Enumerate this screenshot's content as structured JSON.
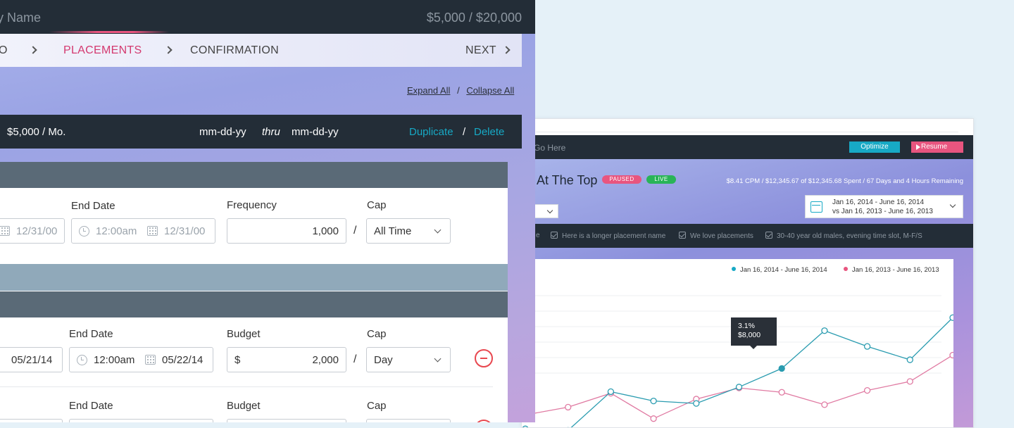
{
  "left": {
    "header": {
      "name": "y Name",
      "budget": "$5,000 / $20,000"
    },
    "steps": {
      "prev": "O",
      "current": "PLACEMENTS",
      "next_step": "CONFIRMATION",
      "next": "NEXT"
    },
    "expand_all": "Expand All",
    "collapse_all": "Collapse All",
    "expand_sep": "/",
    "row": {
      "budget": "$5,000 / Mo.",
      "start": "mm-dd-yy",
      "thru": "thru",
      "end": "mm-dd-yy",
      "duplicate": "Duplicate",
      "sep": "/",
      "delete": "Delete"
    },
    "section1": {
      "start_date": "12/31/00",
      "end_label": "End Date",
      "end_time": "12:00am",
      "end_date": "12/31/00",
      "freq_label": "Frequency",
      "freq_value": "1,000",
      "slash": "/",
      "cap_label": "Cap",
      "cap_value": "All Time"
    },
    "row2": {
      "start_date": "05/21/14",
      "end_label": "End Date",
      "end_time": "12:00am",
      "end_date": "05/22/14",
      "budget_label": "Budget",
      "currency": "$",
      "budget_value": "2,000",
      "slash": "/",
      "cap_label": "Cap",
      "cap_value": "Day"
    },
    "row3": {
      "end_label": "End Date",
      "budget_label": "Budget",
      "cap_label": "Cap"
    }
  },
  "right": {
    "crumb": "Go Here",
    "optimize": "Optimize",
    "resume": "Resume",
    "title": "At The Top",
    "paused": "PAUSED",
    "live": "LIVE",
    "stats": "$8.41 CPM / $12,345.67 of $12,345.68 Spent / 67 Days and 4 Hours Remaining",
    "date_line1": "Jan 16, 2014 - June 16, 2014",
    "date_line2": "vs Jan 16, 2013 - June 16, 2013",
    "filters": [
      "e",
      "Here is a longer placement name",
      "We love placements",
      "30-40 year old males, evening time slot, M-F/S"
    ],
    "tooltip_pct": "3.1%",
    "tooltip_val": "$8,000"
  },
  "colors": {
    "teal": "#17a9c5",
    "pink": "#e8557f",
    "dark": "#232d37",
    "slate": "#5a6a77"
  },
  "chart_data": {
    "type": "line",
    "series": [
      {
        "name": "Jan 16, 2014 - June 16, 2014",
        "color": "#2a9cb0",
        "values": [
          2,
          1.5,
          14,
          11,
          10.2,
          15.5,
          21.5,
          33.7,
          28.6,
          24.3,
          37.9
        ]
      },
      {
        "name": "Jan 16, 2013 - June 16, 2013",
        "color": "#e07aa2",
        "values": [
          6.5,
          9,
          13.5,
          5.3,
          11.6,
          15.2,
          13.8,
          9.8,
          14.4,
          17.3,
          25.8
        ]
      }
    ],
    "ylim": [
      0,
      50
    ],
    "highlight": {
      "series": 0,
      "index": 6
    },
    "legend": "top-right",
    "grid": true
  }
}
